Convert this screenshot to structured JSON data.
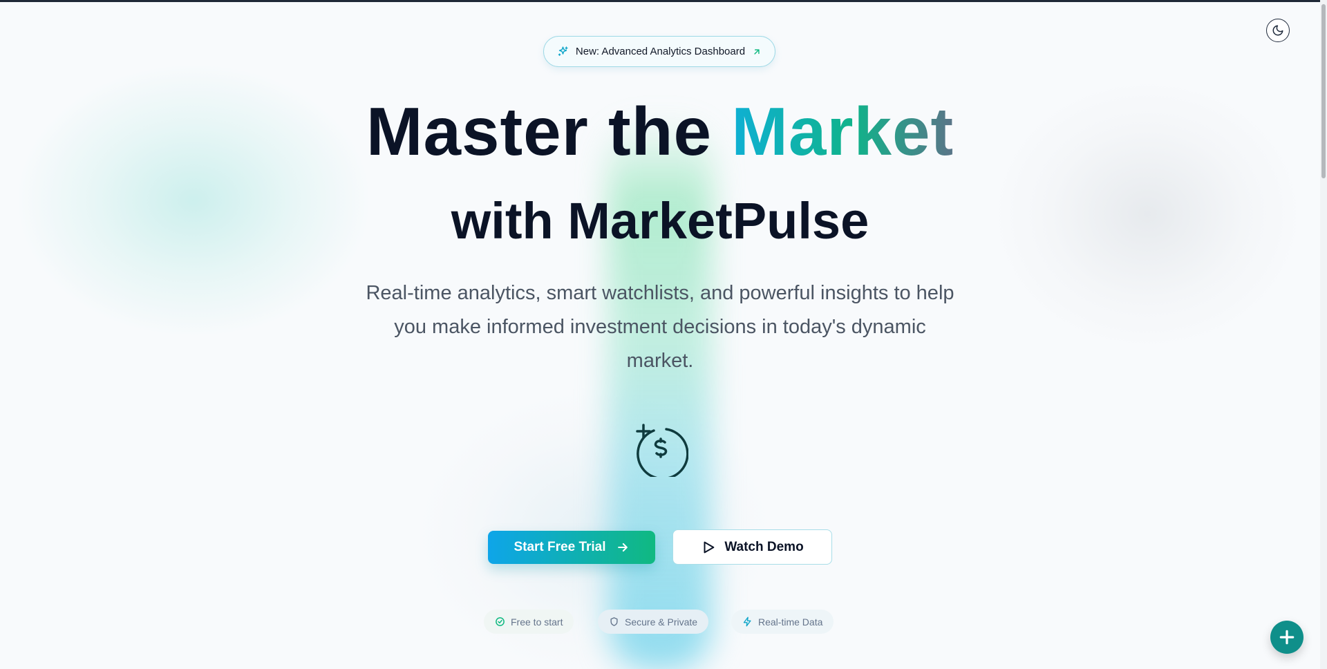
{
  "badge": {
    "label": "New: Advanced Analytics Dashboard",
    "icon": "sparkles-icon",
    "trailing_icon": "arrow-up-right-icon"
  },
  "hero": {
    "title_part1": "Master the ",
    "title_highlight": "Market",
    "title_line2": "with MarketPulse",
    "subtitle": "Real-time analytics, smart watchlists, and powerful insights to help you make informed investment decisions in today's dynamic market."
  },
  "buttons": {
    "primary": "Start Free Trial",
    "secondary": "Watch Demo"
  },
  "features": [
    {
      "label": "Free to start",
      "icon": "check-circle-icon"
    },
    {
      "label": "Secure & Private",
      "icon": "shield-icon"
    },
    {
      "label": "Real-time Data",
      "icon": "lightning-icon"
    }
  ],
  "header": {
    "theme_toggle_icon": "moon-icon"
  },
  "fab": {
    "icon": "plus-icon"
  },
  "colors": {
    "accent_start": "#0ea5e9",
    "accent_end": "#10b981",
    "text_dark": "#0b1326",
    "fab": "#0f8f8a"
  }
}
